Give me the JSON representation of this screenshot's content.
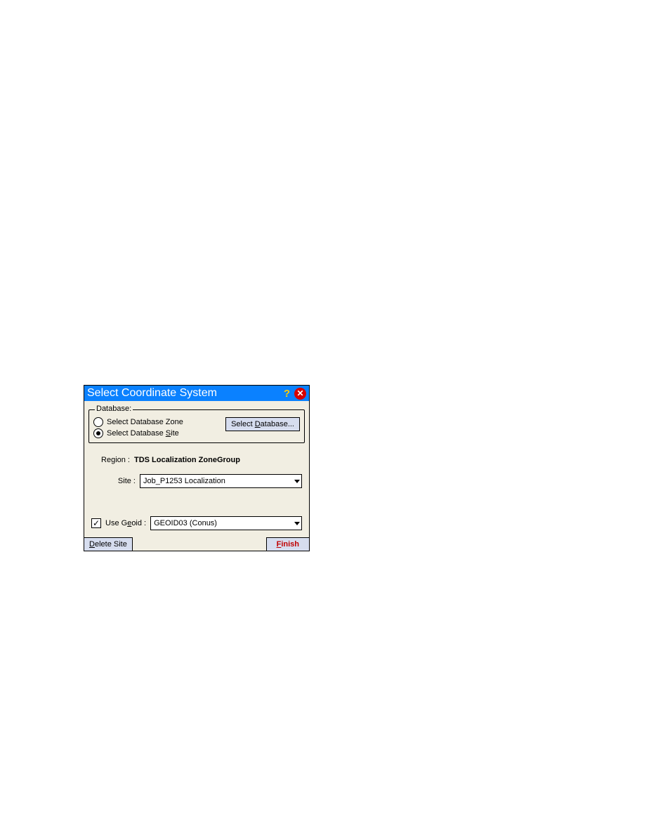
{
  "dialog": {
    "title": "Select Coordinate System",
    "database": {
      "legend": "Database:",
      "radio_zone_label": "Select Database Zone",
      "radio_site_label_pre": "Select Database ",
      "radio_site_label_accel": "S",
      "radio_site_label_post": "ite",
      "select_db_button_pre": "Select ",
      "select_db_button_accel": "D",
      "select_db_button_post": "atabase..."
    },
    "region_label": "Region :",
    "region_value": "TDS Localization ZoneGroup",
    "site_label": "Site :",
    "site_value": "Job_P1253 Localization",
    "geoid_label_pre": "Use G",
    "geoid_label_accel": "e",
    "geoid_label_post": "oid :",
    "geoid_value": "GEOID03 (Conus)",
    "delete_button_accel": "D",
    "delete_button_post": "elete Site",
    "finish_button_accel": "F",
    "finish_button_post": "inish"
  }
}
